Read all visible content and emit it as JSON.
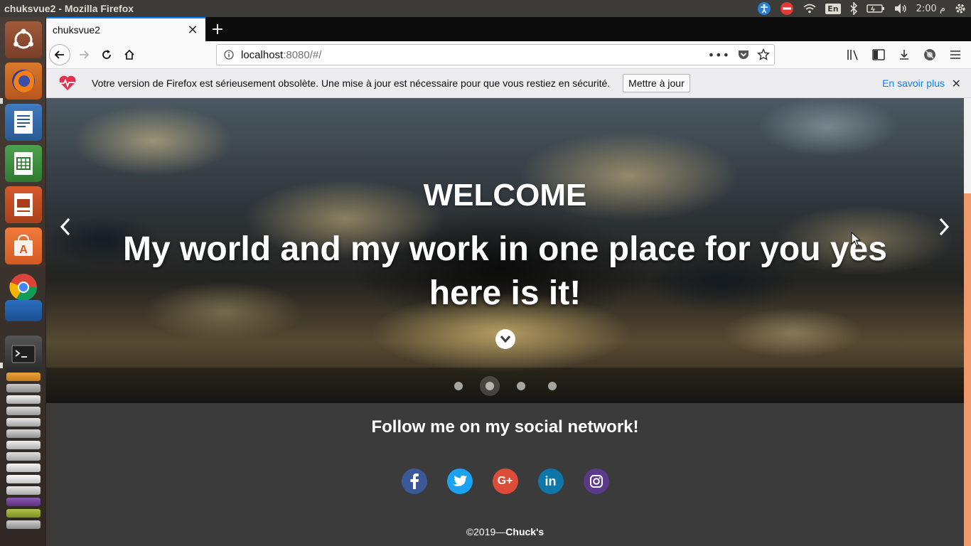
{
  "os_panel": {
    "window_title": "chuksvue2 - Mozilla Firefox",
    "keyboard_layout": "En",
    "clock": "2:00 م"
  },
  "launcher": {
    "items": [
      "ubuntu-dash-icon",
      "firefox-icon",
      "writer-icon",
      "calc-icon",
      "impress-icon",
      "software-center-icon",
      "chrome-icon",
      "app-icon",
      "terminal-icon"
    ]
  },
  "browser": {
    "tab_title": "chuksvue2",
    "url_host": "localhost",
    "url_rest": ":8080/#/",
    "notification": {
      "message": "Votre version de Firefox est sérieusement obsolète. Une mise à jour est nécessaire pour que vous restiez en sécurité.",
      "update_button": "Mettre à jour",
      "learn_more": "En savoir plus"
    }
  },
  "page": {
    "hero": {
      "welcome": "WELCOME",
      "tagline": "My world and my work in one place for you yes here is it!",
      "slide_count": 4,
      "active_slide": 2
    },
    "footer": {
      "title": "Follow me on my social network!",
      "copyright_prefix": "©2019—",
      "copyright_name": "Chuck's",
      "social": [
        {
          "name": "facebook",
          "color": "#3b5998",
          "glyph": "f"
        },
        {
          "name": "twitter",
          "color": "#1da1f2",
          "glyph": "t"
        },
        {
          "name": "google-plus",
          "color": "#dd4b39",
          "glyph": "G+"
        },
        {
          "name": "linkedin",
          "color": "#0e76a8",
          "glyph": "in"
        },
        {
          "name": "instagram",
          "color": "#5b3a8c",
          "glyph": "ig"
        }
      ]
    }
  },
  "colors": {
    "accent": "#0a84ff",
    "scroll_thumb": "#f09a6c",
    "page_bg": "#3b3b3b"
  }
}
